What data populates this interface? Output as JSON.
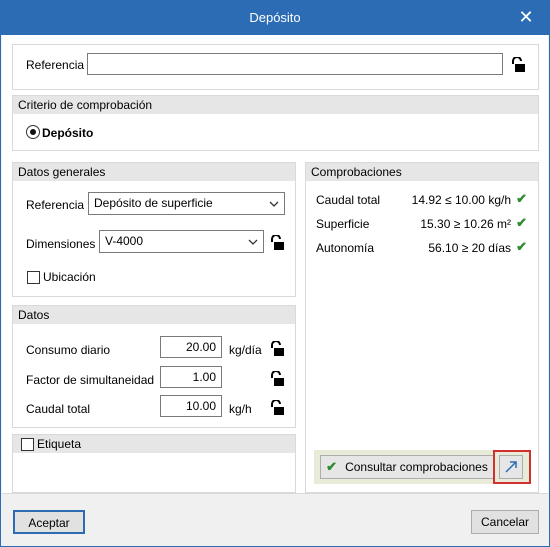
{
  "window": {
    "title": "Depósito"
  },
  "referencia_top": {
    "label": "Referencia",
    "value": ""
  },
  "criterio": {
    "header": "Criterio de comprobación",
    "option_label": "Depósito",
    "selected": true
  },
  "datos_generales": {
    "header": "Datos generales",
    "referencia_label": "Referencia",
    "referencia_value": "Depósito de superficie",
    "dimensiones_label": "Dimensiones",
    "dimensiones_value": "V-4000",
    "ubicacion_label": "Ubicación",
    "ubicacion_checked": false
  },
  "datos": {
    "header": "Datos",
    "rows": [
      {
        "label": "Consumo diario",
        "value": "20.00",
        "unit": "kg/día"
      },
      {
        "label": "Factor de simultaneidad",
        "value": "1.00",
        "unit": ""
      },
      {
        "label": "Caudal total",
        "value": "10.00",
        "unit": "kg/h"
      }
    ]
  },
  "etiqueta": {
    "label": "Etiqueta",
    "checked": false
  },
  "comprobaciones": {
    "header": "Comprobaciones",
    "rows": [
      {
        "label": "Caudal total",
        "value": "14.92 ≤ 10.00 kg/h"
      },
      {
        "label": "Superficie",
        "value": "15.30 ≥ 10.26 m²"
      },
      {
        "label": "Autonomía",
        "value": "56.10 ≥ 20 días"
      }
    ],
    "consult_button": "Consultar comprobaciones"
  },
  "footer": {
    "accept": "Aceptar",
    "cancel": "Cancelar"
  },
  "colors": {
    "titlebar": "#2b6cb5",
    "check": "#2e8b2e",
    "highlight": "#d32f2f"
  }
}
